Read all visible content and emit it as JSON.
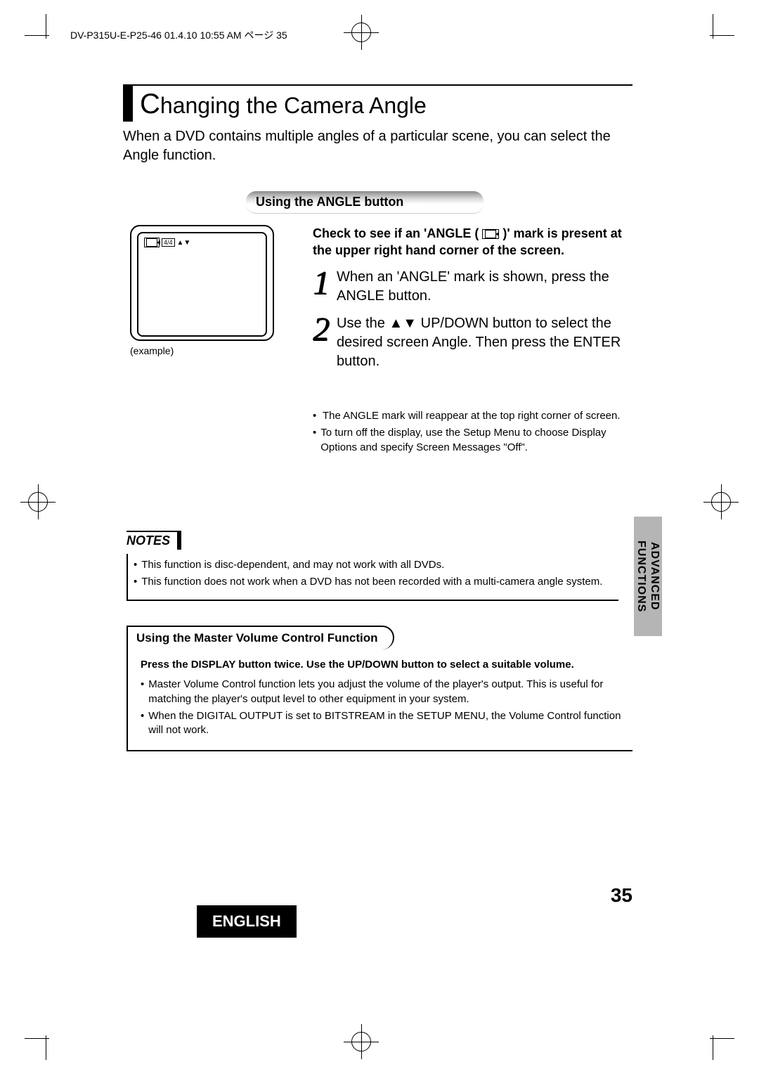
{
  "header_line": "DV-P315U-E-P25-46  01.4.10 10:55 AM  ページ 35",
  "title": "Changing the Camera Angle",
  "intro": "When a DVD contains multiple angles of a particular scene, you can select the Angle function.",
  "subhead": "Using the ANGLE button",
  "example": {
    "indicator": "4/4",
    "arrows": "▲▼",
    "label": "(example)"
  },
  "check_text_pre": "Check to see if an 'ANGLE ( ",
  "check_text_post": " )' mark is present at the upper right hand corner of the screen.",
  "steps": [
    {
      "num": "1",
      "text": "When an 'ANGLE' mark is shown, press the ANGLE button."
    },
    {
      "num": "2",
      "text_pre": "Use the ",
      "arrows": "▲▼",
      "text_post": " UP/DOWN button to select the desired screen Angle. Then press the ENTER button."
    }
  ],
  "sub_bullets": [
    "The ANGLE mark will reappear at the top right corner of screen.",
    "To turn off the display, use the Setup Menu to choose Display Options and specify Screen  Messages \"Off\"."
  ],
  "side_tab": {
    "line1": "ADVANCED",
    "line2": "FUNCTIONS"
  },
  "notes": {
    "header": "NOTES",
    "items": [
      "This function is disc-dependent, and may not work with all DVDs.",
      "This function does not work when a DVD has not been recorded with a multi-camera angle system."
    ]
  },
  "volume": {
    "header": "Using the Master Volume Control Function",
    "lead": "Press the DISPLAY button twice. Use the UP/DOWN button to select a suitable volume.",
    "items": [
      "Master Volume Control function lets you adjust the volume of the player's output. This is useful for matching the player's output level to other equipment in your system.",
      "When the  DIGITAL OUTPUT is set to BITSTREAM in the SETUP MENU, the Volume Control function will not work."
    ]
  },
  "page_number": "35",
  "language": "ENGLISH"
}
